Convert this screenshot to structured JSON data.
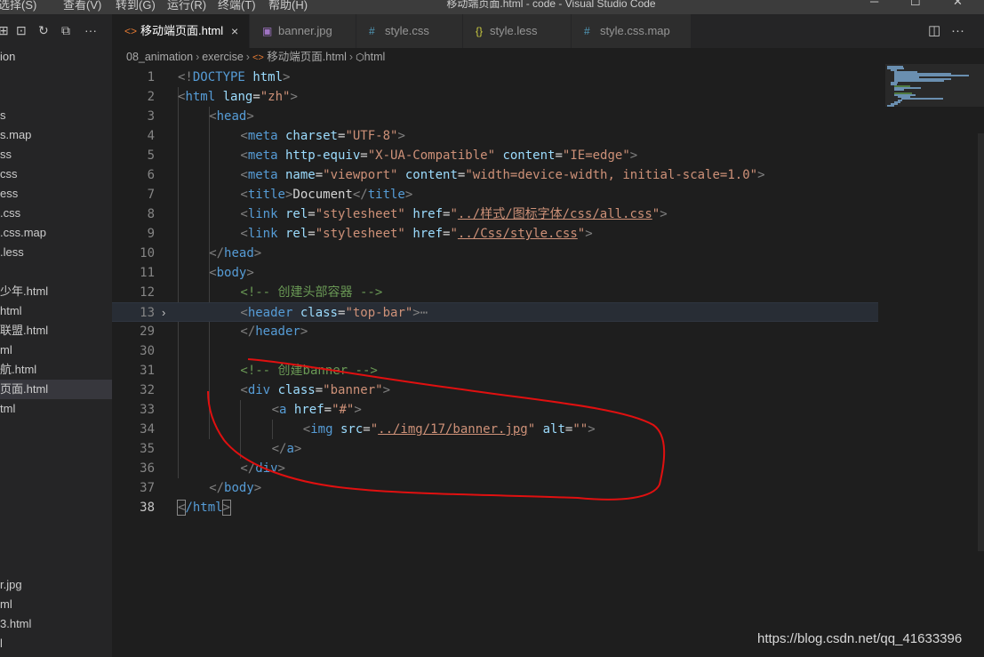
{
  "titlebar": {
    "menus": [
      "选择(S)",
      "查看(V)",
      "转到(G)",
      "运行(R)",
      "终端(T)",
      "帮助(H)"
    ],
    "window_title": "移动端页面.html - code - Visual Studio Code",
    "controls": {
      "minimize": "─",
      "maximize": "☐",
      "close": "✕"
    }
  },
  "sidebar": {
    "toolbar_icons": [
      "new-file-icon",
      "new-folder-icon",
      "refresh-icon",
      "collapse-all-icon",
      "more-actions-icon"
    ],
    "items": [
      {
        "label": "ion"
      },
      {
        "label": "s"
      },
      {
        "label": "s.map"
      },
      {
        "label": "ss"
      },
      {
        "label": "css"
      },
      {
        "label": "ess"
      },
      {
        "label": ".css"
      },
      {
        "label": ".css.map"
      },
      {
        "label": ".less"
      },
      {
        "label": "少年.html"
      },
      {
        "label": "html"
      },
      {
        "label": "联盟.html"
      },
      {
        "label": "ml"
      },
      {
        "label": "航.html"
      },
      {
        "label": "页面.html",
        "active": true
      },
      {
        "label": "tml"
      },
      {
        "label": "r.jpg"
      },
      {
        "label": "ml"
      },
      {
        "label": "3.html"
      },
      {
        "label": "l"
      }
    ]
  },
  "tabs": [
    {
      "label": "移动端页面.html",
      "icon": "<>",
      "active": true,
      "close": "×"
    },
    {
      "label": "banner.jpg",
      "icon": "▣"
    },
    {
      "label": "style.css",
      "icon": "#"
    },
    {
      "label": "style.less",
      "icon": "{}"
    },
    {
      "label": "style.css.map",
      "icon": "#"
    }
  ],
  "tab_actions": {
    "split": "◫",
    "more": "···"
  },
  "breadcrumb": [
    "08_animation",
    "exercise",
    "移动端页面.html",
    "html"
  ],
  "editor": {
    "current_line": 38,
    "highlighted_line": 13,
    "lines": [
      {
        "n": "1",
        "indent": 0,
        "tokens": [
          [
            "br",
            "<!"
          ],
          [
            "tag",
            "DOCTYPE"
          ],
          [
            "txt",
            " "
          ],
          [
            "att",
            "html"
          ],
          [
            "br",
            ">"
          ]
        ]
      },
      {
        "n": "2",
        "indent": 0,
        "tokens": [
          [
            "br",
            "<"
          ],
          [
            "tag",
            "html"
          ],
          [
            "txt",
            " "
          ],
          [
            "att",
            "lang"
          ],
          [
            "txt",
            "="
          ],
          [
            "str",
            "\"zh\""
          ],
          [
            "br",
            ">"
          ]
        ]
      },
      {
        "n": "3",
        "indent": 1,
        "tokens": [
          [
            "br",
            "<"
          ],
          [
            "tag",
            "head"
          ],
          [
            "br",
            ">"
          ]
        ]
      },
      {
        "n": "4",
        "indent": 2,
        "tokens": [
          [
            "br",
            "<"
          ],
          [
            "tag",
            "meta"
          ],
          [
            "txt",
            " "
          ],
          [
            "att",
            "charset"
          ],
          [
            "txt",
            "="
          ],
          [
            "str",
            "\"UTF-8\""
          ],
          [
            "br",
            ">"
          ]
        ]
      },
      {
        "n": "5",
        "indent": 2,
        "tokens": [
          [
            "br",
            "<"
          ],
          [
            "tag",
            "meta"
          ],
          [
            "txt",
            " "
          ],
          [
            "att",
            "http-equiv"
          ],
          [
            "txt",
            "="
          ],
          [
            "str",
            "\"X-UA-Compatible\""
          ],
          [
            "txt",
            " "
          ],
          [
            "att",
            "content"
          ],
          [
            "txt",
            "="
          ],
          [
            "str",
            "\"IE=edge\""
          ],
          [
            "br",
            ">"
          ]
        ]
      },
      {
        "n": "6",
        "indent": 2,
        "tokens": [
          [
            "br",
            "<"
          ],
          [
            "tag",
            "meta"
          ],
          [
            "txt",
            " "
          ],
          [
            "att",
            "name"
          ],
          [
            "txt",
            "="
          ],
          [
            "str",
            "\"viewport\""
          ],
          [
            "txt",
            " "
          ],
          [
            "att",
            "content"
          ],
          [
            "txt",
            "="
          ],
          [
            "str",
            "\"width=device-width, initial-scale=1.0\""
          ],
          [
            "br",
            ">"
          ]
        ]
      },
      {
        "n": "7",
        "indent": 2,
        "tokens": [
          [
            "br",
            "<"
          ],
          [
            "tag",
            "title"
          ],
          [
            "br",
            ">"
          ],
          [
            "txt",
            "Document"
          ],
          [
            "br",
            "</"
          ],
          [
            "tag",
            "title"
          ],
          [
            "br",
            ">"
          ]
        ]
      },
      {
        "n": "8",
        "indent": 2,
        "tokens": [
          [
            "br",
            "<"
          ],
          [
            "tag",
            "link"
          ],
          [
            "txt",
            " "
          ],
          [
            "att",
            "rel"
          ],
          [
            "txt",
            "="
          ],
          [
            "str",
            "\"stylesheet\""
          ],
          [
            "txt",
            " "
          ],
          [
            "att",
            "href"
          ],
          [
            "txt",
            "="
          ],
          [
            "str",
            "\""
          ],
          [
            "strlink",
            "../样式/图标字体/css/all.css"
          ],
          [
            "str",
            "\""
          ],
          [
            "br",
            ">"
          ]
        ]
      },
      {
        "n": "9",
        "indent": 2,
        "tokens": [
          [
            "br",
            "<"
          ],
          [
            "tag",
            "link"
          ],
          [
            "txt",
            " "
          ],
          [
            "att",
            "rel"
          ],
          [
            "txt",
            "="
          ],
          [
            "str",
            "\"stylesheet\""
          ],
          [
            "txt",
            " "
          ],
          [
            "att",
            "href"
          ],
          [
            "txt",
            "="
          ],
          [
            "str",
            "\""
          ],
          [
            "strlink",
            "../Css/style.css"
          ],
          [
            "str",
            "\""
          ],
          [
            "br",
            ">"
          ]
        ]
      },
      {
        "n": "10",
        "indent": 1,
        "tokens": [
          [
            "br",
            "</"
          ],
          [
            "tag",
            "head"
          ],
          [
            "br",
            ">"
          ]
        ]
      },
      {
        "n": "11",
        "indent": 1,
        "tokens": [
          [
            "br",
            "<"
          ],
          [
            "tag",
            "body"
          ],
          [
            "br",
            ">"
          ]
        ]
      },
      {
        "n": "12",
        "indent": 2,
        "tokens": [
          [
            "cmt",
            "<!-- 创建头部容器 -->"
          ]
        ]
      },
      {
        "n": "13",
        "indent": 2,
        "fold": "›",
        "tokens": [
          [
            "br",
            "<"
          ],
          [
            "tag",
            "header"
          ],
          [
            "txt",
            " "
          ],
          [
            "att",
            "class"
          ],
          [
            "txt",
            "="
          ],
          [
            "str",
            "\"top-bar\""
          ],
          [
            "br",
            ">"
          ],
          [
            "fold",
            "⋯"
          ]
        ]
      },
      {
        "n": "29",
        "indent": 2,
        "tokens": [
          [
            "br",
            "</"
          ],
          [
            "tag",
            "header"
          ],
          [
            "br",
            ">"
          ]
        ]
      },
      {
        "n": "30",
        "indent": 2,
        "tokens": []
      },
      {
        "n": "31",
        "indent": 2,
        "tokens": [
          [
            "cmt",
            "<!-- 创建banner -->"
          ]
        ]
      },
      {
        "n": "32",
        "indent": 2,
        "tokens": [
          [
            "br",
            "<"
          ],
          [
            "tag",
            "div"
          ],
          [
            "txt",
            " "
          ],
          [
            "att",
            "class"
          ],
          [
            "txt",
            "="
          ],
          [
            "str",
            "\"banner\""
          ],
          [
            "br",
            ">"
          ]
        ]
      },
      {
        "n": "33",
        "indent": 3,
        "tokens": [
          [
            "br",
            "<"
          ],
          [
            "tag",
            "a"
          ],
          [
            "txt",
            " "
          ],
          [
            "att",
            "href"
          ],
          [
            "txt",
            "="
          ],
          [
            "str",
            "\"#\""
          ],
          [
            "br",
            ">"
          ]
        ]
      },
      {
        "n": "34",
        "indent": 4,
        "tokens": [
          [
            "br",
            "<"
          ],
          [
            "tag",
            "img"
          ],
          [
            "txt",
            " "
          ],
          [
            "att",
            "src"
          ],
          [
            "txt",
            "="
          ],
          [
            "str",
            "\""
          ],
          [
            "strlink",
            "../img/17/banner.jpg"
          ],
          [
            "str",
            "\""
          ],
          [
            "txt",
            " "
          ],
          [
            "att",
            "alt"
          ],
          [
            "txt",
            "="
          ],
          [
            "str",
            "\"\""
          ],
          [
            "br",
            ">"
          ]
        ]
      },
      {
        "n": "35",
        "indent": 3,
        "tokens": [
          [
            "br",
            "</"
          ],
          [
            "tag",
            "a"
          ],
          [
            "br",
            ">"
          ]
        ]
      },
      {
        "n": "36",
        "indent": 2,
        "tokens": [
          [
            "br",
            "</"
          ],
          [
            "tag",
            "div"
          ],
          [
            "br",
            ">"
          ]
        ]
      },
      {
        "n": "37",
        "indent": 1,
        "tokens": [
          [
            "br",
            "</"
          ],
          [
            "tag",
            "body"
          ],
          [
            "br",
            ">"
          ]
        ]
      },
      {
        "n": "38",
        "indent": 0,
        "tokens": [
          [
            "brm",
            "<"
          ],
          [
            "tag",
            "/html"
          ],
          [
            "brm",
            ">"
          ]
        ]
      }
    ]
  },
  "watermark": "https://blog.csdn.net/qq_41633396",
  "colors": {
    "annotation": "#e01010",
    "accent": "#e37933"
  }
}
